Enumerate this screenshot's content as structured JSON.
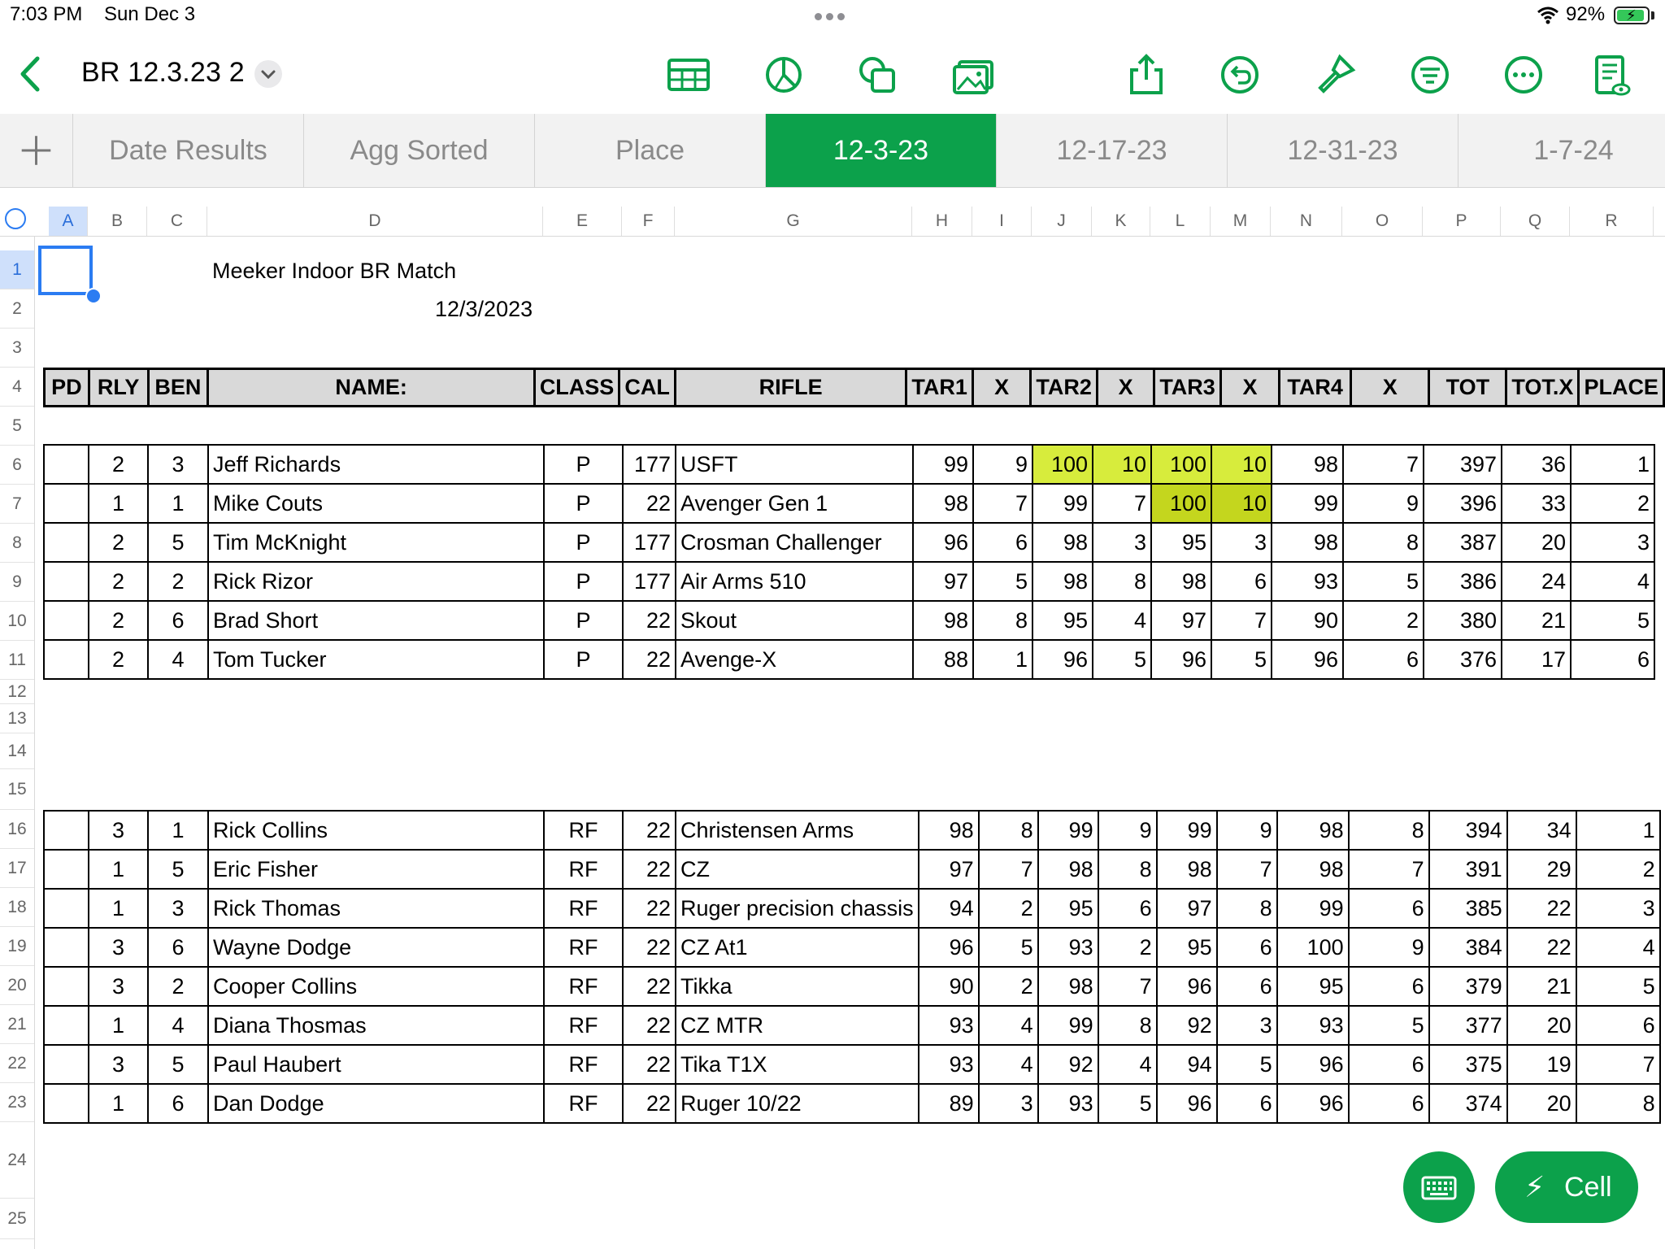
{
  "status": {
    "time": "7:03 PM",
    "date": "Sun Dec 3",
    "battery": "92%",
    "battery_level": 0.92
  },
  "toolbar": {
    "title": "BR 12.3.23 2",
    "icons": [
      "table-icon",
      "chart-icon",
      "shapes-icon",
      "media-icon",
      "share-icon",
      "undo-icon",
      "format-brush-icon",
      "organize-icon",
      "more-icon",
      "document-view-icon"
    ]
  },
  "tabs": [
    {
      "label": "Date Results",
      "active": false
    },
    {
      "label": "Agg Sorted",
      "active": false
    },
    {
      "label": "Place",
      "active": false
    },
    {
      "label": "12-3-23",
      "active": true
    },
    {
      "label": "12-17-23",
      "active": false
    },
    {
      "label": "12-31-23",
      "active": false
    },
    {
      "label": "1-7-24",
      "active": false
    }
  ],
  "columns": [
    "A",
    "B",
    "C",
    "D",
    "E",
    "F",
    "G",
    "H",
    "I",
    "J",
    "K",
    "L",
    "M",
    "N",
    "O",
    "P",
    "Q",
    "R"
  ],
  "rows": [
    "1",
    "2",
    "3",
    "4",
    "5",
    "6",
    "7",
    "8",
    "9",
    "10",
    "11",
    "12",
    "13",
    "14",
    "15",
    "16",
    "17",
    "18",
    "19",
    "20",
    "21",
    "22",
    "23",
    "24",
    "25"
  ],
  "sheet": {
    "title": "Meeker Indoor BR Match",
    "date": "12/3/2023",
    "headers": [
      "PD",
      "RLY",
      "BEN",
      "NAME:",
      "CLASS",
      "CAL",
      "RIFLE",
      "TAR1",
      "X",
      "TAR2",
      "X",
      "TAR3",
      "X",
      "TAR4",
      "X",
      "TOT",
      "TOT.X",
      "PLACE"
    ],
    "group1": [
      [
        "",
        "2",
        "3",
        "Jeff Richards",
        "P",
        "177",
        "USFT",
        "99",
        "9",
        "100",
        "10",
        "100",
        "10",
        "98",
        "7",
        "397",
        "36",
        "1"
      ],
      [
        "",
        "1",
        "1",
        "Mike Couts",
        "P",
        "22",
        "Avenger Gen 1",
        "98",
        "7",
        "99",
        "7",
        "100",
        "10",
        "99",
        "9",
        "396",
        "33",
        "2"
      ],
      [
        "",
        "2",
        "5",
        "Tim McKnight",
        "P",
        "177",
        "Crosman Challenger",
        "96",
        "6",
        "98",
        "3",
        "95",
        "3",
        "98",
        "8",
        "387",
        "20",
        "3"
      ],
      [
        "",
        "2",
        "2",
        "Rick Rizor",
        "P",
        "177",
        "Air Arms 510",
        "97",
        "5",
        "98",
        "8",
        "98",
        "6",
        "93",
        "5",
        "386",
        "24",
        "4"
      ],
      [
        "",
        "2",
        "6",
        "Brad Short",
        "P",
        "22",
        "Skout",
        "98",
        "8",
        "95",
        "4",
        "97",
        "7",
        "90",
        "2",
        "380",
        "21",
        "5"
      ],
      [
        "",
        "2",
        "4",
        "Tom Tucker",
        "P",
        "22",
        "Avenge-X",
        "88",
        "1",
        "96",
        "5",
        "96",
        "5",
        "96",
        "6",
        "376",
        "17",
        "6"
      ]
    ],
    "group2": [
      [
        "",
        "3",
        "1",
        "Rick Collins",
        "RF",
        "22",
        "Christensen Arms",
        "98",
        "8",
        "99",
        "9",
        "99",
        "9",
        "98",
        "8",
        "394",
        "34",
        "1"
      ],
      [
        "",
        "1",
        "5",
        "Eric Fisher",
        "RF",
        "22",
        "CZ",
        "97",
        "7",
        "98",
        "8",
        "98",
        "7",
        "98",
        "7",
        "391",
        "29",
        "2"
      ],
      [
        "",
        "1",
        "3",
        "Rick Thomas",
        "RF",
        "22",
        "Ruger precision chassis",
        "94",
        "2",
        "95",
        "6",
        "97",
        "8",
        "99",
        "6",
        "385",
        "22",
        "3"
      ],
      [
        "",
        "3",
        "6",
        "Wayne Dodge",
        "RF",
        "22",
        "CZ At1",
        "96",
        "5",
        "93",
        "2",
        "95",
        "6",
        "100",
        "9",
        "384",
        "22",
        "4"
      ],
      [
        "",
        "3",
        "2",
        "Cooper Collins",
        "RF",
        "22",
        "Tikka",
        "90",
        "2",
        "98",
        "7",
        "96",
        "6",
        "95",
        "6",
        "379",
        "21",
        "5"
      ],
      [
        "",
        "1",
        "4",
        "Diana Thosmas",
        "RF",
        "22",
        "CZ MTR",
        "93",
        "4",
        "99",
        "8",
        "92",
        "3",
        "93",
        "5",
        "377",
        "20",
        "6"
      ],
      [
        "",
        "3",
        "5",
        "Paul Haubert",
        "RF",
        "22",
        "Tika T1X",
        "93",
        "4",
        "92",
        "4",
        "94",
        "5",
        "96",
        "6",
        "375",
        "19",
        "7"
      ],
      [
        "",
        "1",
        "6",
        "Dan Dodge",
        "RF",
        "22",
        "Ruger 10/22",
        "89",
        "3",
        "93",
        "5",
        "96",
        "6",
        "96",
        "6",
        "374",
        "20",
        "8"
      ]
    ],
    "highlights": {
      "color": "#d7ec3c",
      "color_dark": "#c4d61e"
    }
  },
  "bottom": {
    "cell_label": "Cell"
  }
}
